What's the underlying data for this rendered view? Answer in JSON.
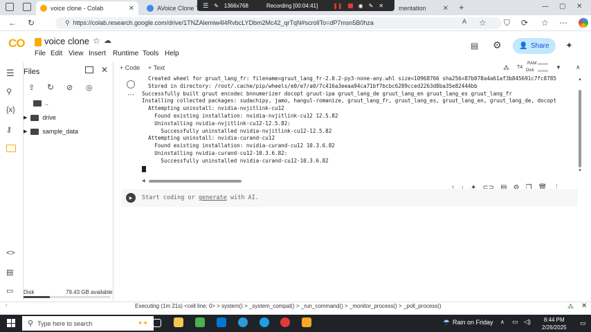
{
  "browser": {
    "tabs": [
      {
        "label": "voice clone - Colab",
        "color": "#f9ab00",
        "active": true
      },
      {
        "label": "AVoice Clone Tut",
        "color": "#4285f4",
        "active": false
      },
      {
        "label": "mentation",
        "color": "#888888",
        "active": false
      }
    ],
    "recorder": {
      "size": "1366x768",
      "status": "Recording [00:04:41]"
    },
    "url": "https://colab.research.google.com/drive/1TNZAlemiw4l4RvbcLYDbm2Mc42_qrTqN#scrollTo=dP7msn5B0hza"
  },
  "colab": {
    "logo": "CO",
    "title": "voice clone",
    "menu": [
      "File",
      "Edit",
      "View",
      "Insert",
      "Runtime",
      "Tools",
      "Help"
    ],
    "share_label": "Share",
    "add_code": "+ Code",
    "add_text": "+ Text",
    "runtime_label": "T4",
    "ram_label": "RAM",
    "disk_label": "Disk"
  },
  "files": {
    "title": "Files",
    "items": [
      {
        "label": ".."
      },
      {
        "label": "drive"
      },
      {
        "label": "sample_data"
      }
    ],
    "disk_label": "Disk",
    "disk_available": "79.43 GB available",
    "disk_used_fraction": 0.3
  },
  "output": {
    "lines": [
      "  Created wheel for gruut_lang_fr: filename=gruut_lang_fr-2.0.2-py3-none-any.whl size=10968766 sha256=87b078a4a61af3b845691c7fc8785",
      "  Stored in directory: /root/.cache/pip/wheels/e0/e7/a0/7c416a3eeaa94ca71bf7bcbc6289cced2263d8ba35e82444bb",
      "Successfully built gruut encodec bnnumerizer docopt gruut-ipa gruut_lang_de gruut_lang_en gruut_lang_es gruut_lang_fr",
      "Installing collected packages: sudachipy, jamo, hangul-romanize, gruut_lang_fr, gruut_lang_es, gruut_lang_en, gruut_lang_de, docopt",
      "  Attempting uninstall: nvidia-nvjitlink-cu12",
      "    Found existing installation: nvidia-nvjitlink-cu12 12.5.82",
      "    Uninstalling nvidia-nvjitlink-cu12-12.5.82:",
      "      Successfully uninstalled nvidia-nvjitlink-cu12-12.5.82",
      "  Attempting uninstall: nvidia-curand-cu12",
      "    Found existing installation: nvidia-curand-cu12 10.3.6.82",
      "    Uninstalling nvidia-curand-cu12-10.3.6.82:",
      "      Successfully uninstalled nvidia-curand-cu12-10.3.6.82"
    ]
  },
  "new_cell": {
    "prompt_start": "Start coding or ",
    "prompt_link": "generate",
    "prompt_end": " with AI."
  },
  "status_bar": {
    "text": "Executing (1m 21s)  <cell line: 0>  >  system()  >  _system_compat()  >  _run_command()  >  _monitor_process()  >  _poll_process()"
  },
  "taskbar": {
    "search_placeholder": "Type here to search",
    "weather": "Rain on Friday",
    "time": "8:44 PM",
    "date": "2/26/2025"
  }
}
